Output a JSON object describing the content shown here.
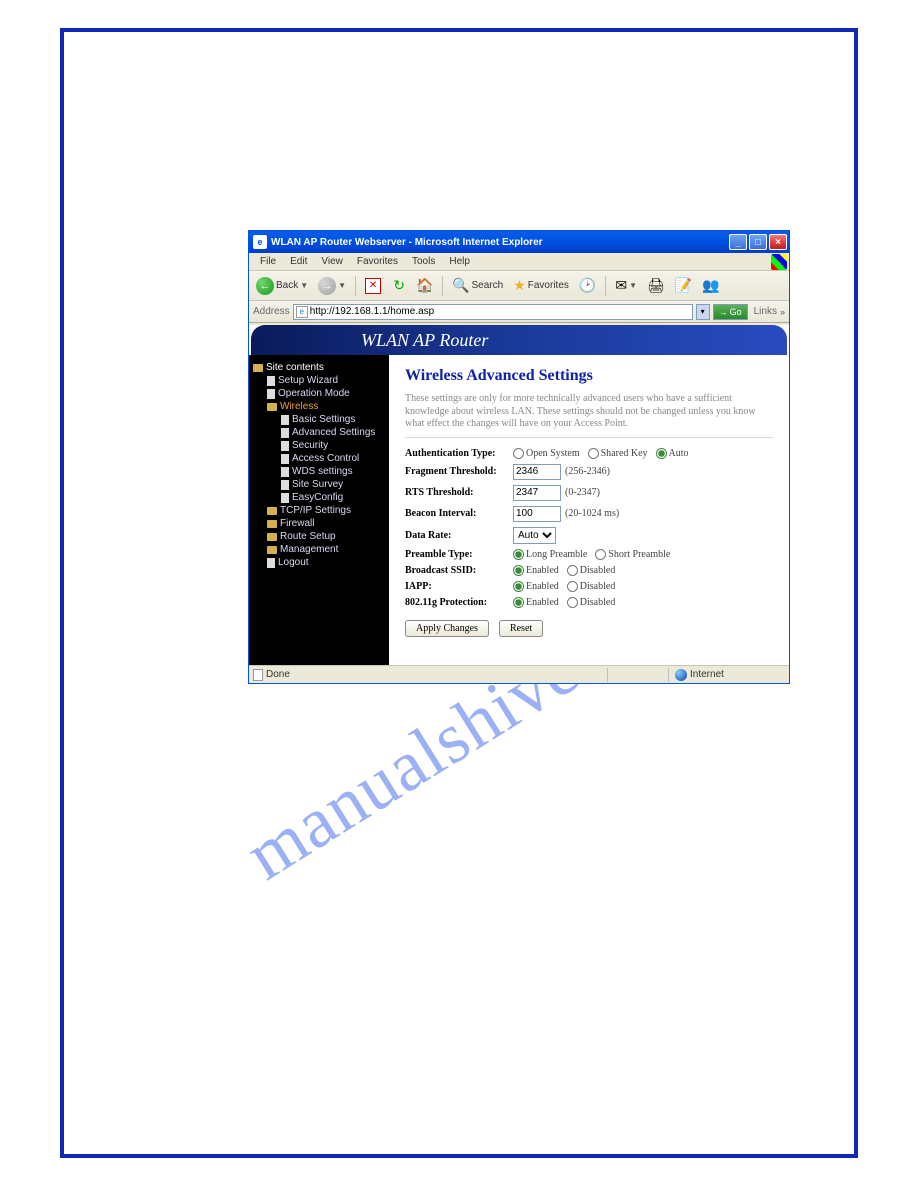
{
  "watermark": "manualshive.com",
  "titlebar": {
    "text": "WLAN AP Router Webserver - Microsoft Internet Explorer"
  },
  "menus": [
    "File",
    "Edit",
    "View",
    "Favorites",
    "Tools",
    "Help"
  ],
  "toolbar": {
    "back": "Back",
    "search": "Search",
    "favorites": "Favorites"
  },
  "address": {
    "label": "Address",
    "value": "http://192.168.1.1/home.asp",
    "go": "Go",
    "links": "Links"
  },
  "banner": "WLAN AP Router",
  "sidebar": {
    "root": "Site contents",
    "items": [
      {
        "label": "Setup Wizard",
        "type": "page",
        "level": 1
      },
      {
        "label": "Operation Mode",
        "type": "page",
        "level": 1
      },
      {
        "label": "Wireless",
        "type": "folder",
        "level": 1,
        "active": true
      },
      {
        "label": "Basic Settings",
        "type": "page",
        "level": 2
      },
      {
        "label": "Advanced Settings",
        "type": "page",
        "level": 2
      },
      {
        "label": "Security",
        "type": "page",
        "level": 2
      },
      {
        "label": "Access Control",
        "type": "page",
        "level": 2
      },
      {
        "label": "WDS settings",
        "type": "page",
        "level": 2
      },
      {
        "label": "Site Survey",
        "type": "page",
        "level": 2
      },
      {
        "label": "EasyConfig",
        "type": "page",
        "level": 2
      },
      {
        "label": "TCP/IP Settings",
        "type": "folder",
        "level": 1
      },
      {
        "label": "Firewall",
        "type": "folder",
        "level": 1
      },
      {
        "label": "Route Setup",
        "type": "folder",
        "level": 1
      },
      {
        "label": "Management",
        "type": "folder",
        "level": 1
      },
      {
        "label": "Logout",
        "type": "page",
        "level": 1
      }
    ]
  },
  "panel": {
    "title": "Wireless Advanced Settings",
    "desc": "These settings are only for more technically advanced users who have a sufficient knowledge about wireless LAN. These settings should not be changed unless you know what effect the changes will have on your Access Point.",
    "auth_label": "Authentication Type:",
    "auth_opts": {
      "open": "Open System",
      "shared": "Shared Key",
      "auto": "Auto"
    },
    "frag_label": "Fragment Threshold:",
    "frag_value": "2346",
    "frag_hint": "(256-2346)",
    "rts_label": "RTS Threshold:",
    "rts_value": "2347",
    "rts_hint": "(0-2347)",
    "beacon_label": "Beacon Interval:",
    "beacon_value": "100",
    "beacon_hint": "(20-1024 ms)",
    "rate_label": "Data Rate:",
    "rate_value": "Auto",
    "preamble_label": "Preamble Type:",
    "preamble_opts": {
      "long": "Long Preamble",
      "short": "Short Preamble"
    },
    "ssid_label": "Broadcast SSID:",
    "iapp_label": "IAPP:",
    "prot_label": "802.11g Protection:",
    "enabled": "Enabled",
    "disabled": "Disabled",
    "apply": "Apply Changes",
    "reset": "Reset"
  },
  "status": {
    "done": "Done",
    "zone": "Internet"
  }
}
